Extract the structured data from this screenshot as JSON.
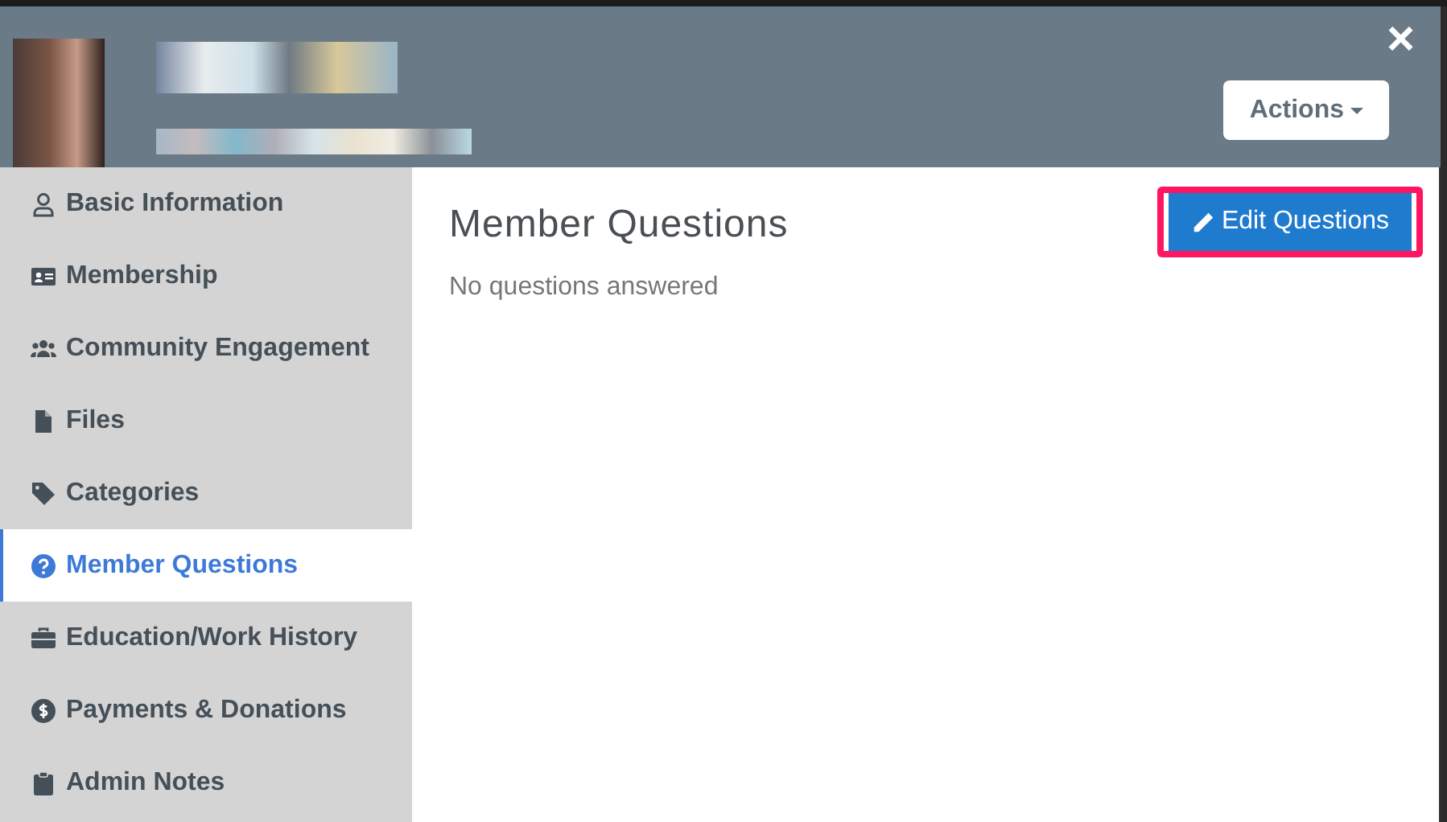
{
  "header": {
    "close": "×",
    "actions_button": "Actions"
  },
  "sidebar": {
    "items": [
      {
        "label": "Basic Information",
        "selected": false
      },
      {
        "label": "Membership",
        "selected": false
      },
      {
        "label": "Community Engagement",
        "selected": false
      },
      {
        "label": "Files",
        "selected": false
      },
      {
        "label": "Categories",
        "selected": false
      },
      {
        "label": "Member Questions",
        "selected": true
      },
      {
        "label": "Education/Work History",
        "selected": false
      },
      {
        "label": "Payments & Donations",
        "selected": false
      },
      {
        "label": "Admin Notes",
        "selected": false
      }
    ]
  },
  "content": {
    "title": "Member Questions",
    "edit_button": "Edit Questions",
    "highlighted": true,
    "message": "No questions answered"
  }
}
